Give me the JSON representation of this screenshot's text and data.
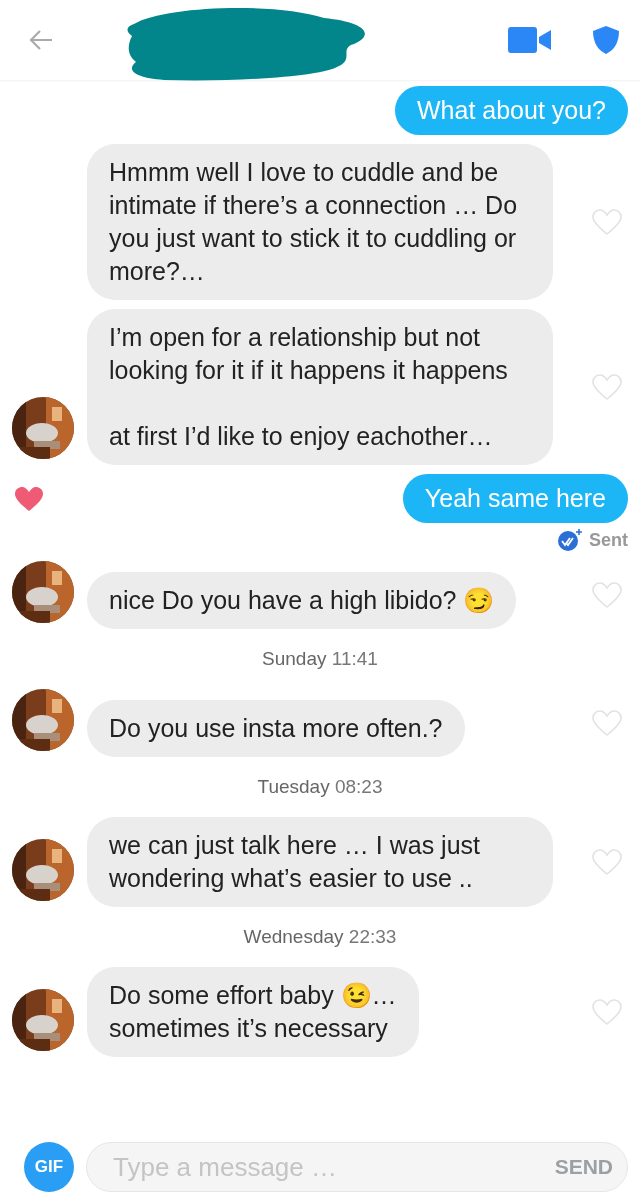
{
  "messages": [
    {
      "kind": "outgoing",
      "text": "What about you?",
      "liked": false
    },
    {
      "kind": "incoming",
      "text": "Hmmm well I love to cuddle and be intimate if there’s a connection … Do you just want to stick it to cuddling or more?…",
      "avatar": false,
      "liked": false
    },
    {
      "kind": "incoming",
      "text": "I’m open for a relationship but not looking for it if it happens it happens\n\nat first I’d like to enjoy eachother…",
      "avatar": true,
      "liked": false
    },
    {
      "kind": "outgoing",
      "text": "Yeah same here",
      "liked": true,
      "status": "Sent"
    },
    {
      "kind": "incoming",
      "text": "nice Do you have a high libido? 😏",
      "avatar": true,
      "liked": false
    },
    {
      "kind": "timestamp",
      "day": "Sunday",
      "time": "11:41"
    },
    {
      "kind": "incoming",
      "text": "Do you use insta more often.?",
      "avatar": true,
      "liked": false
    },
    {
      "kind": "timestamp",
      "day": "Tuesday",
      "time": "08:23"
    },
    {
      "kind": "incoming",
      "text": "we can just talk here … I was just wondering what’s easier to use ..",
      "avatar": true,
      "liked": false
    },
    {
      "kind": "timestamp",
      "day": "Wednesday",
      "time": "22:33"
    },
    {
      "kind": "incoming",
      "text": "Do some effort baby 😉…\nsometimes it’s necessary",
      "avatar": true,
      "liked": false
    }
  ],
  "composer": {
    "gif_label": "GIF",
    "placeholder": "Type a message …",
    "send_label": "SEND"
  }
}
